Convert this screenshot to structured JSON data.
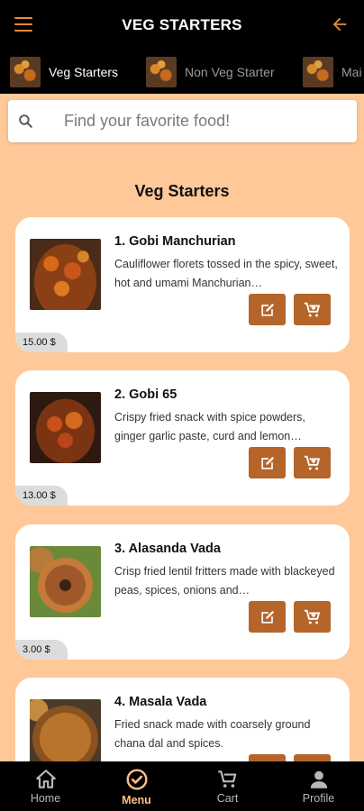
{
  "header": {
    "title": "VEG STARTERS"
  },
  "categories": [
    {
      "label": "Veg Starters",
      "active": true
    },
    {
      "label": "Non Veg Starter",
      "active": false
    },
    {
      "label": "Mai",
      "active": false
    }
  ],
  "search": {
    "placeholder": "Find your favorite food!",
    "value": ""
  },
  "section_title": "Veg Starters",
  "items": [
    {
      "name": "1. Gobi Manchurian",
      "description": "Cauliflower florets tossed in the spicy, sweet, hot and umami Manchurian…",
      "price": "15.00 $",
      "image": "gobi-manchurian-photo"
    },
    {
      "name": "2. Gobi 65",
      "description": "Crispy fried snack with spice powders, ginger garlic paste, curd and lemon…",
      "price": "13.00 $",
      "image": "gobi-65-photo"
    },
    {
      "name": "3. Alasanda Vada",
      "description": "Crisp fried lentil fritters made with blackeyed peas, spices, onions and…",
      "price": "3.00 $",
      "image": "alasanda-vada-photo"
    },
    {
      "name": "4. Masala Vada",
      "description": "Fried snack made with coarsely ground chana dal and spices.",
      "price": "",
      "image": "masala-vada-photo"
    }
  ],
  "nav": [
    {
      "label": "Home",
      "icon": "home-icon"
    },
    {
      "label": "Menu",
      "icon": "check-circle-icon",
      "active": true
    },
    {
      "label": "Cart",
      "icon": "cart-icon"
    },
    {
      "label": "Profile",
      "icon": "person-icon"
    }
  ],
  "colors": {
    "accent": "#e8893a",
    "button": "#b5652a",
    "background": "#ffc899",
    "nav_active": "#ffbf86"
  }
}
